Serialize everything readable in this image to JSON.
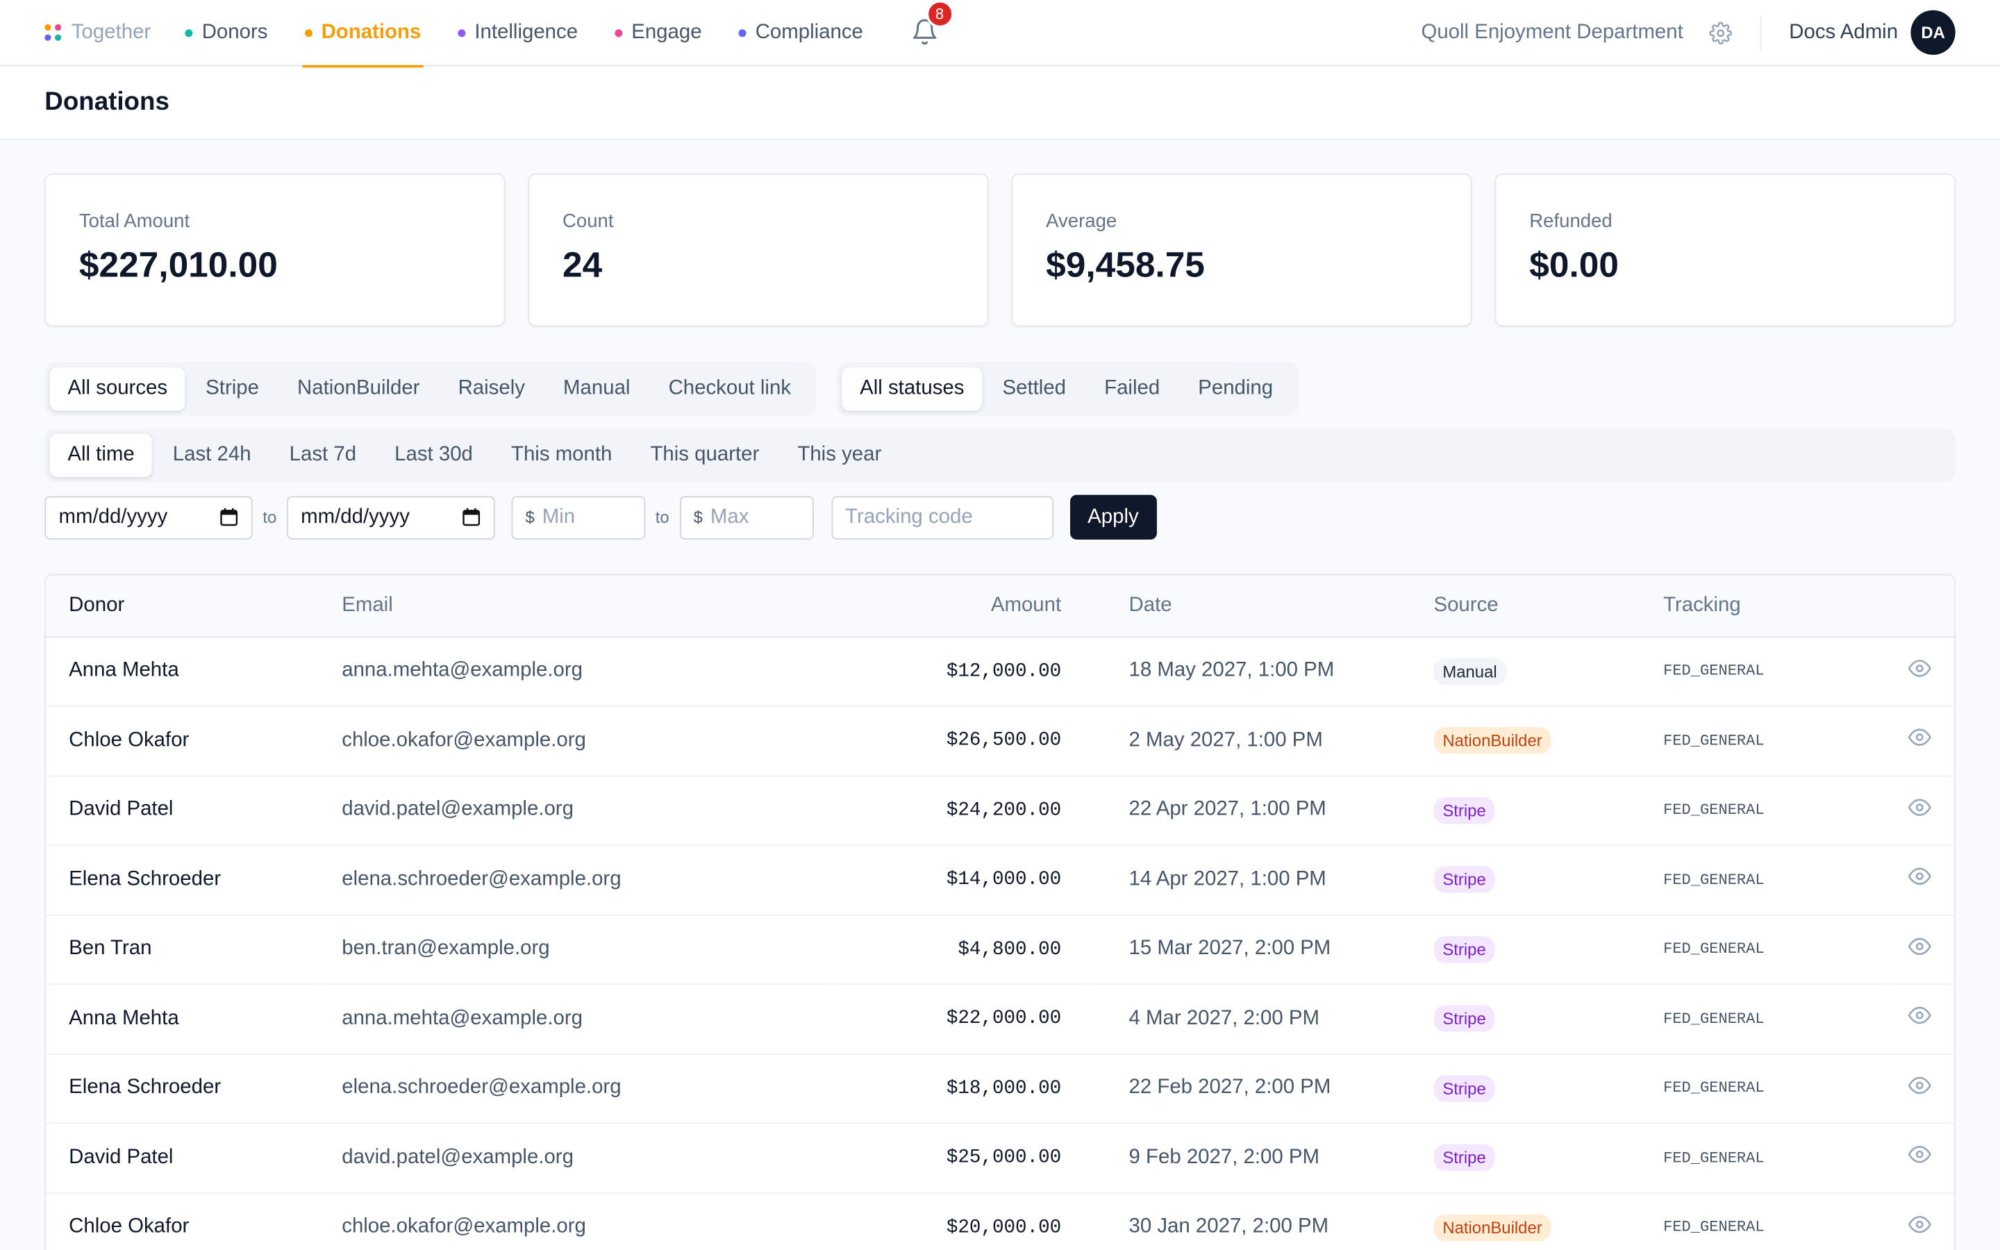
{
  "nav": {
    "brand": "Together",
    "brand_colors": [
      "#f59e0b",
      "#ec4899",
      "#6366f1",
      "#14b8a6"
    ],
    "items": [
      {
        "label": "Donors",
        "color": "#14b8a6"
      },
      {
        "label": "Donations",
        "color": "#f59e0b"
      },
      {
        "label": "Intelligence",
        "color": "#8b5cf6"
      },
      {
        "label": "Engage",
        "color": "#ec4899"
      },
      {
        "label": "Compliance",
        "color": "#6366f1"
      }
    ],
    "active": "Donations",
    "notification_count": "8",
    "org_name": "Quoll Enjoyment Department",
    "user_name": "Docs Admin",
    "user_initials": "DA"
  },
  "page": {
    "title": "Donations"
  },
  "stats": [
    {
      "label": "Total Amount",
      "value": "$227,010.00"
    },
    {
      "label": "Count",
      "value": "24"
    },
    {
      "label": "Average",
      "value": "$9,458.75"
    },
    {
      "label": "Refunded",
      "value": "$0.00"
    }
  ],
  "sources": {
    "options": [
      "All sources",
      "Stripe",
      "NationBuilder",
      "Raisely",
      "Manual",
      "Checkout link"
    ],
    "selected": "All sources"
  },
  "statuses": {
    "options": [
      "All statuses",
      "Settled",
      "Failed",
      "Pending"
    ],
    "selected": "All statuses"
  },
  "periods": {
    "options": [
      "All time",
      "Last 24h",
      "Last 7d",
      "Last 30d",
      "This month",
      "This quarter",
      "This year"
    ],
    "selected": "All time"
  },
  "filters": {
    "date_from_placeholder": "mm/dd/yyyy",
    "date_to_placeholder": "mm/dd/yyyy",
    "to_label": "to",
    "currency_symbol": "$",
    "min_placeholder": "Min",
    "max_placeholder": "Max",
    "tracking_placeholder": "Tracking code",
    "apply_label": "Apply"
  },
  "table": {
    "columns": {
      "donor": "Donor",
      "email": "Email",
      "amount": "Amount",
      "date": "Date",
      "source": "Source",
      "tracking": "Tracking"
    },
    "rows": [
      {
        "donor": "Anna Mehta",
        "email": "anna.mehta@example.org",
        "amount": "$12,000.00",
        "date": "18 May 2027, 1:00 PM",
        "source": "Manual",
        "tracking": "FED_GENERAL"
      },
      {
        "donor": "Chloe Okafor",
        "email": "chloe.okafor@example.org",
        "amount": "$26,500.00",
        "date": "2 May 2027, 1:00 PM",
        "source": "NationBuilder",
        "tracking": "FED_GENERAL"
      },
      {
        "donor": "David Patel",
        "email": "david.patel@example.org",
        "amount": "$24,200.00",
        "date": "22 Apr 2027, 1:00 PM",
        "source": "Stripe",
        "tracking": "FED_GENERAL"
      },
      {
        "donor": "Elena Schroeder",
        "email": "elena.schroeder@example.org",
        "amount": "$14,000.00",
        "date": "14 Apr 2027, 1:00 PM",
        "source": "Stripe",
        "tracking": "FED_GENERAL"
      },
      {
        "donor": "Ben Tran",
        "email": "ben.tran@example.org",
        "amount": "$4,800.00",
        "date": "15 Mar 2027, 2:00 PM",
        "source": "Stripe",
        "tracking": "FED_GENERAL"
      },
      {
        "donor": "Anna Mehta",
        "email": "anna.mehta@example.org",
        "amount": "$22,000.00",
        "date": "4 Mar 2027, 2:00 PM",
        "source": "Stripe",
        "tracking": "FED_GENERAL"
      },
      {
        "donor": "Elena Schroeder",
        "email": "elena.schroeder@example.org",
        "amount": "$18,000.00",
        "date": "22 Feb 2027, 2:00 PM",
        "source": "Stripe",
        "tracking": "FED_GENERAL"
      },
      {
        "donor": "David Patel",
        "email": "david.patel@example.org",
        "amount": "$25,000.00",
        "date": "9 Feb 2027, 2:00 PM",
        "source": "Stripe",
        "tracking": "FED_GENERAL"
      },
      {
        "donor": "Chloe Okafor",
        "email": "chloe.okafor@example.org",
        "amount": "$20,000.00",
        "date": "30 Jan 2027, 2:00 PM",
        "source": "NationBuilder",
        "tracking": "FED_GENERAL"
      }
    ]
  }
}
